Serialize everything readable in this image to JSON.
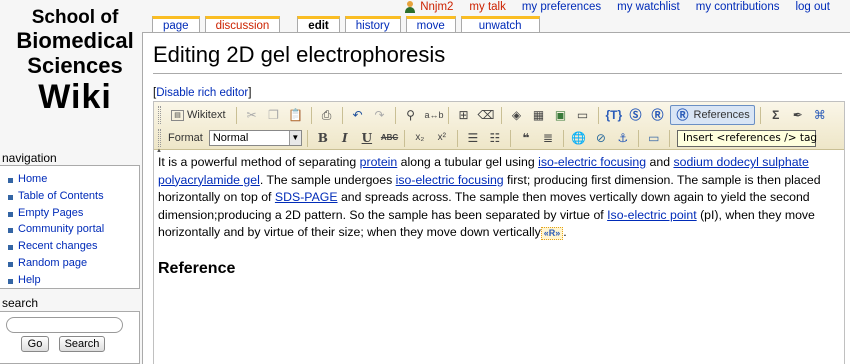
{
  "logo": {
    "line1": "School of",
    "line2": "Biomedical",
    "line3": "Sciences",
    "line4": "Wiki"
  },
  "personal": {
    "username": "Nnjm2",
    "talk": "my talk",
    "preferences": "my preferences",
    "watchlist": "my watchlist",
    "contributions": "my contributions",
    "logout": "log out"
  },
  "tabs": {
    "page": "page",
    "discussion": "discussion",
    "edit": "edit",
    "history": "history",
    "move": "move",
    "unwatch": "unwatch"
  },
  "page": {
    "title": "Editing 2D gel electrophoresis",
    "toggle_open": "[",
    "toggle_link": "Disable rich editor",
    "toggle_close": "]"
  },
  "toolbar": {
    "wikitext": "Wikitext",
    "references": "References",
    "format_label": "Format",
    "format_value": "Normal",
    "tooltip": "Insert <references /> tag"
  },
  "content": {
    "t1": "It is a powerful method of separating ",
    "l1": "protein",
    "t2": " along a tubular gel using ",
    "l2": "iso-electric focusing",
    "t3": " and ",
    "l3": "sodium dodecyl sulphate polyacrylamide gel",
    "t4": ". The sample undergoes ",
    "l4": "iso-electric focusing",
    "t5": " first; producing first dimension. The sample is then placed horizontally on top of ",
    "l5": "SDS-PAGE",
    "t6": " and spreads across. The sample then moves vertically down again to yield the second dimension;producing a 2D pattern. So the sample has been separated by virtue of ",
    "l6": "Iso-electric point",
    "t7": " (pI), when they move horizontally and by virtue of their size; when they move down vertically",
    "ref_marker": "«R»",
    "t8": ".",
    "heading": "Reference"
  },
  "navigation": {
    "title": "navigation",
    "items": [
      "Home",
      "Table of Contents",
      "Empty Pages",
      "Community portal",
      "Recent changes",
      "Random page",
      "Help"
    ]
  },
  "search": {
    "title": "search",
    "go": "Go",
    "search": "Search"
  }
}
